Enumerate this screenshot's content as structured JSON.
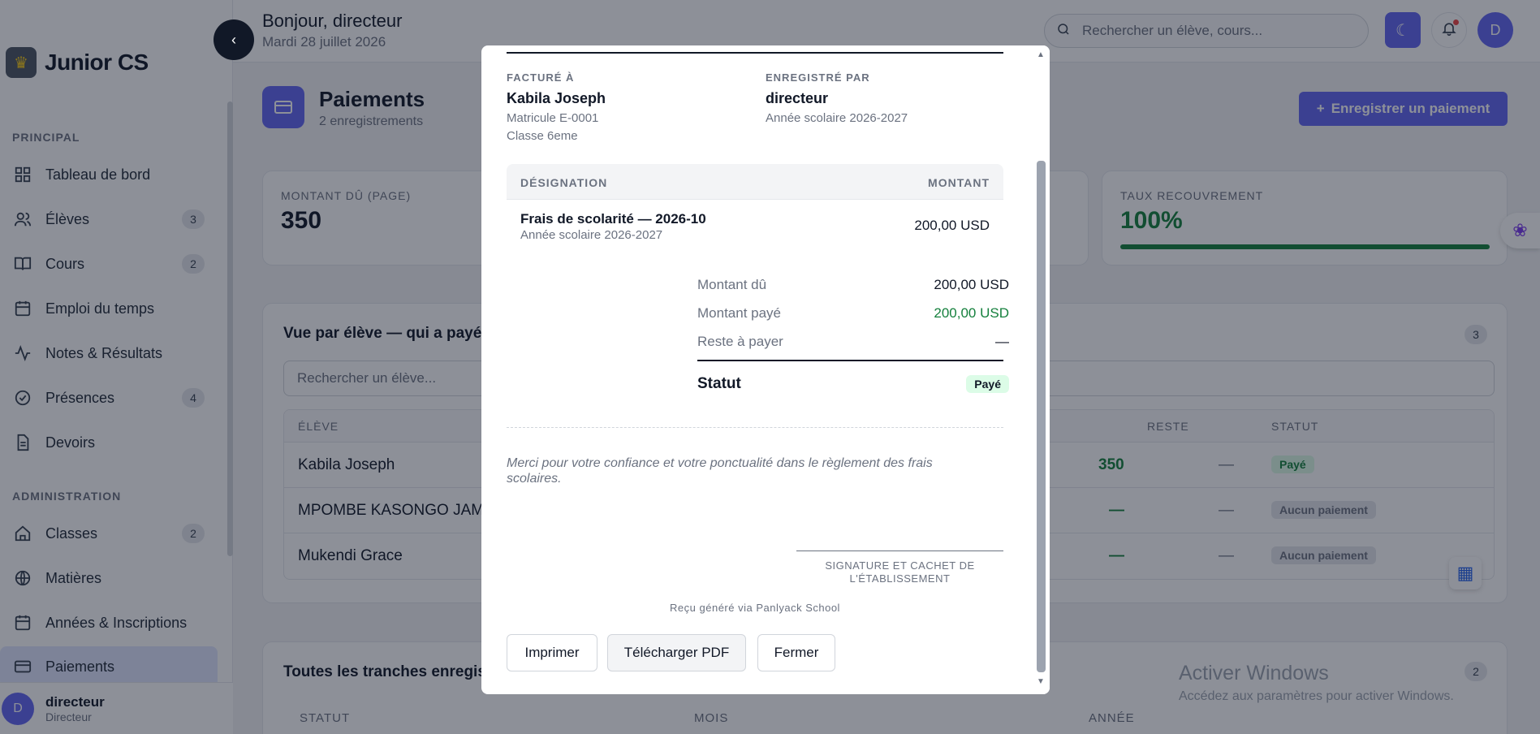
{
  "brand": {
    "name": "Junior CS"
  },
  "header": {
    "greeting": "Bonjour, directeur",
    "date": "Mardi 28 juillet 2026",
    "search_placeholder": "Rechercher un élève, cours...",
    "avatar_initial": "D"
  },
  "sidebar": {
    "section_principal": "PRINCIPAL",
    "section_admin": "ADMINISTRATION",
    "items": [
      {
        "label": "Tableau de bord",
        "icon": "grid-icon",
        "count": ""
      },
      {
        "label": "Élèves",
        "icon": "users-icon",
        "count": "3"
      },
      {
        "label": "Cours",
        "icon": "book-icon",
        "count": "2"
      },
      {
        "label": "Emploi du temps",
        "icon": "calendar-icon",
        "count": ""
      },
      {
        "label": "Notes & Résultats",
        "icon": "activity-icon",
        "count": ""
      },
      {
        "label": "Présences",
        "icon": "check-circle-icon",
        "count": "4"
      },
      {
        "label": "Devoirs",
        "icon": "file-icon",
        "count": ""
      },
      {
        "label": "Classes",
        "icon": "home-icon",
        "count": "2"
      },
      {
        "label": "Matières",
        "icon": "globe-icon",
        "count": ""
      },
      {
        "label": "Années & Inscriptions",
        "icon": "calendar-icon",
        "count": ""
      },
      {
        "label": "Paiements",
        "icon": "card-icon",
        "count": ""
      }
    ],
    "user": {
      "initial": "D",
      "name": "directeur",
      "role": "Directeur"
    }
  },
  "main": {
    "title": "Paiements",
    "subtitle": "2 enregistrements",
    "primary_button": "Enregistrer un paiement",
    "stats": [
      {
        "label": "MONTANT DÛ (PAGE)",
        "value": "350"
      },
      {
        "label": "TAUX RECOUVREMENT",
        "value": "100%",
        "progress": 1.0
      }
    ],
    "student_view": {
      "title": "Vue par élève — qui a payé, c",
      "count": "3",
      "filter_placeholder": "Rechercher un élève...",
      "columns": [
        "ÉLÈVE",
        "RESTE",
        "STATUT"
      ],
      "rows": [
        {
          "name": "Kabila Joseph",
          "paid": "350",
          "reste": "—",
          "statut": "Payé"
        },
        {
          "name": "MPOMBE KASONGO JAM",
          "paid": "—",
          "reste": "—",
          "statut": "Aucun paiement"
        },
        {
          "name": "Mukendi Grace",
          "paid": "—",
          "reste": "—",
          "statut": "Aucun paiement"
        }
      ]
    },
    "tranches": {
      "title": "Toutes les tranches enregistr",
      "count": "2",
      "columns": [
        "STATUT",
        "MOIS",
        "ANNÉE"
      ]
    },
    "watermark": {
      "title": "Activer Windows",
      "sub": "Accédez aux paramètres pour activer Windows."
    }
  },
  "receipt": {
    "billed_to_label": "FACTURÉ À",
    "billed_name": "Kabila Joseph",
    "matricule": "Matricule E-0001",
    "classe": "Classe 6eme",
    "recorded_by_label": "ENREGISTRÉ PAR",
    "recorded_by": "directeur",
    "school_year": "Année scolaire 2026-2027",
    "table": {
      "col_designation": "DÉSIGNATION",
      "col_montant": "MONTANT",
      "item_name": "Frais de scolarité — 2026-10",
      "item_sub": "Année scolaire 2026-2027",
      "item_amount": "200,00 USD"
    },
    "summary": {
      "due_label": "Montant dû",
      "due_value": "200,00 USD",
      "paid_label": "Montant payé",
      "paid_value": "200,00 USD",
      "rest_label": "Reste à payer",
      "rest_value": "—",
      "status_label": "Statut",
      "status_value": "Payé"
    },
    "thanks": "Merci pour votre confiance et votre ponctualité dans le règlement des frais scolaires.",
    "signature": "SIGNATURE ET CACHET DE L'ÉTABLISSEMENT",
    "generated": "Reçu généré via Panlyack School",
    "buttons": {
      "print": "Imprimer",
      "pdf": "Télécharger PDF",
      "close": "Fermer"
    }
  }
}
